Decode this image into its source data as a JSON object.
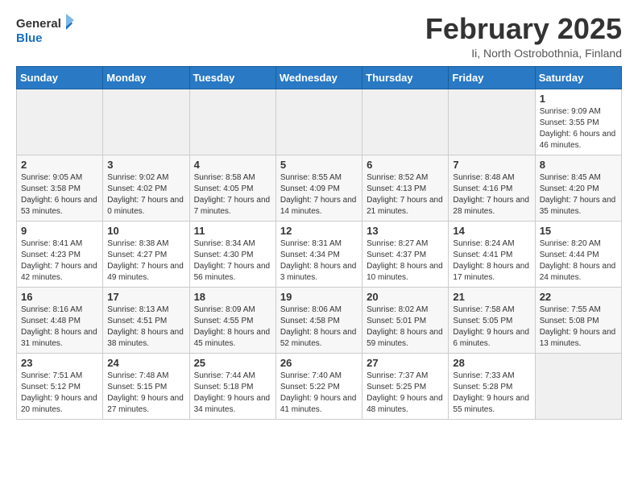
{
  "header": {
    "logo_general": "General",
    "logo_blue": "Blue",
    "title": "February 2025",
    "subtitle": "Ii, North Ostrobothnia, Finland"
  },
  "weekdays": [
    "Sunday",
    "Monday",
    "Tuesday",
    "Wednesday",
    "Thursday",
    "Friday",
    "Saturday"
  ],
  "weeks": [
    [
      {
        "day": "",
        "info": ""
      },
      {
        "day": "",
        "info": ""
      },
      {
        "day": "",
        "info": ""
      },
      {
        "day": "",
        "info": ""
      },
      {
        "day": "",
        "info": ""
      },
      {
        "day": "",
        "info": ""
      },
      {
        "day": "1",
        "info": "Sunrise: 9:09 AM\nSunset: 3:55 PM\nDaylight: 6 hours and 46 minutes."
      }
    ],
    [
      {
        "day": "2",
        "info": "Sunrise: 9:05 AM\nSunset: 3:58 PM\nDaylight: 6 hours and 53 minutes."
      },
      {
        "day": "3",
        "info": "Sunrise: 9:02 AM\nSunset: 4:02 PM\nDaylight: 7 hours and 0 minutes."
      },
      {
        "day": "4",
        "info": "Sunrise: 8:58 AM\nSunset: 4:05 PM\nDaylight: 7 hours and 7 minutes."
      },
      {
        "day": "5",
        "info": "Sunrise: 8:55 AM\nSunset: 4:09 PM\nDaylight: 7 hours and 14 minutes."
      },
      {
        "day": "6",
        "info": "Sunrise: 8:52 AM\nSunset: 4:13 PM\nDaylight: 7 hours and 21 minutes."
      },
      {
        "day": "7",
        "info": "Sunrise: 8:48 AM\nSunset: 4:16 PM\nDaylight: 7 hours and 28 minutes."
      },
      {
        "day": "8",
        "info": "Sunrise: 8:45 AM\nSunset: 4:20 PM\nDaylight: 7 hours and 35 minutes."
      }
    ],
    [
      {
        "day": "9",
        "info": "Sunrise: 8:41 AM\nSunset: 4:23 PM\nDaylight: 7 hours and 42 minutes."
      },
      {
        "day": "10",
        "info": "Sunrise: 8:38 AM\nSunset: 4:27 PM\nDaylight: 7 hours and 49 minutes."
      },
      {
        "day": "11",
        "info": "Sunrise: 8:34 AM\nSunset: 4:30 PM\nDaylight: 7 hours and 56 minutes."
      },
      {
        "day": "12",
        "info": "Sunrise: 8:31 AM\nSunset: 4:34 PM\nDaylight: 8 hours and 3 minutes."
      },
      {
        "day": "13",
        "info": "Sunrise: 8:27 AM\nSunset: 4:37 PM\nDaylight: 8 hours and 10 minutes."
      },
      {
        "day": "14",
        "info": "Sunrise: 8:24 AM\nSunset: 4:41 PM\nDaylight: 8 hours and 17 minutes."
      },
      {
        "day": "15",
        "info": "Sunrise: 8:20 AM\nSunset: 4:44 PM\nDaylight: 8 hours and 24 minutes."
      }
    ],
    [
      {
        "day": "16",
        "info": "Sunrise: 8:16 AM\nSunset: 4:48 PM\nDaylight: 8 hours and 31 minutes."
      },
      {
        "day": "17",
        "info": "Sunrise: 8:13 AM\nSunset: 4:51 PM\nDaylight: 8 hours and 38 minutes."
      },
      {
        "day": "18",
        "info": "Sunrise: 8:09 AM\nSunset: 4:55 PM\nDaylight: 8 hours and 45 minutes."
      },
      {
        "day": "19",
        "info": "Sunrise: 8:06 AM\nSunset: 4:58 PM\nDaylight: 8 hours and 52 minutes."
      },
      {
        "day": "20",
        "info": "Sunrise: 8:02 AM\nSunset: 5:01 PM\nDaylight: 8 hours and 59 minutes."
      },
      {
        "day": "21",
        "info": "Sunrise: 7:58 AM\nSunset: 5:05 PM\nDaylight: 9 hours and 6 minutes."
      },
      {
        "day": "22",
        "info": "Sunrise: 7:55 AM\nSunset: 5:08 PM\nDaylight: 9 hours and 13 minutes."
      }
    ],
    [
      {
        "day": "23",
        "info": "Sunrise: 7:51 AM\nSunset: 5:12 PM\nDaylight: 9 hours and 20 minutes."
      },
      {
        "day": "24",
        "info": "Sunrise: 7:48 AM\nSunset: 5:15 PM\nDaylight: 9 hours and 27 minutes."
      },
      {
        "day": "25",
        "info": "Sunrise: 7:44 AM\nSunset: 5:18 PM\nDaylight: 9 hours and 34 minutes."
      },
      {
        "day": "26",
        "info": "Sunrise: 7:40 AM\nSunset: 5:22 PM\nDaylight: 9 hours and 41 minutes."
      },
      {
        "day": "27",
        "info": "Sunrise: 7:37 AM\nSunset: 5:25 PM\nDaylight: 9 hours and 48 minutes."
      },
      {
        "day": "28",
        "info": "Sunrise: 7:33 AM\nSunset: 5:28 PM\nDaylight: 9 hours and 55 minutes."
      },
      {
        "day": "",
        "info": ""
      }
    ]
  ]
}
